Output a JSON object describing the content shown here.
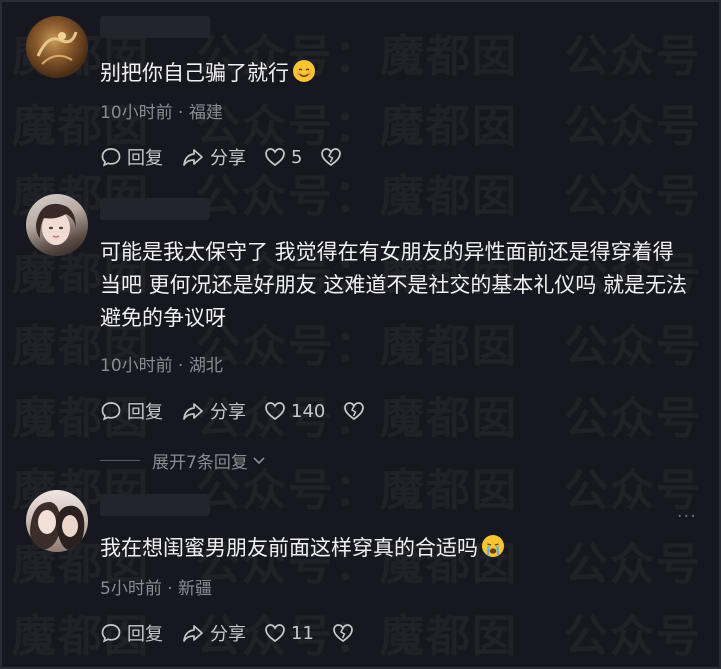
{
  "watermark": "魔都囡  公众号：",
  "comments": [
    {
      "text": "别把你自己骗了就行",
      "emoji": "smile-emoji",
      "time": "10小时前",
      "location": "福建",
      "reply_label": "回复",
      "share_label": "分享",
      "likes": "5"
    },
    {
      "text": "可能是我太保守了 我觉得在有女朋友的异性面前还是得穿着得当吧 更何况还是好朋友 这难道不是社交的基本礼仪吗 就是无法避免的争议呀",
      "time": "10小时前",
      "location": "湖北",
      "reply_label": "回复",
      "share_label": "分享",
      "likes": "140"
    },
    {
      "text": "我在想闺蜜男朋友前面这样穿真的合适吗",
      "emoji": "crying-emoji",
      "time": "5小时前",
      "location": "新疆",
      "reply_label": "回复",
      "share_label": "分享",
      "likes": "11",
      "more": "···"
    }
  ],
  "expand_replies": "展开7条回复",
  "separator": "·"
}
